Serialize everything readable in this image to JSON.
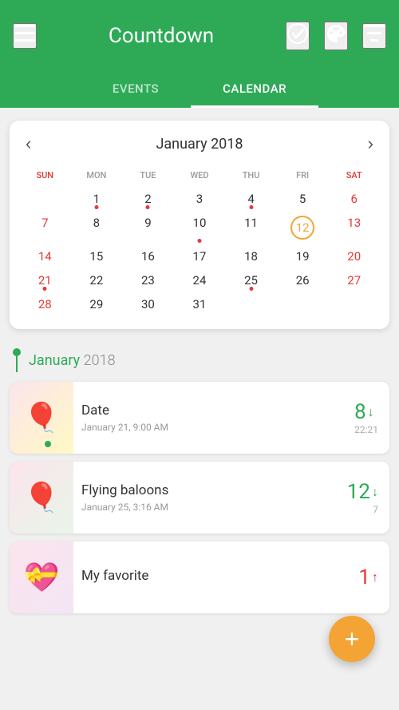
{
  "header": {
    "title": "Countdown",
    "menu_icon": "☰",
    "check_icon": "✓",
    "palette_icon": "🎨",
    "sort_icon": "≡"
  },
  "tabs": [
    {
      "label": "EVENTS",
      "active": false
    },
    {
      "label": "CALENDAR",
      "active": true
    }
  ],
  "calendar": {
    "title": "January 2018",
    "prev_label": "‹",
    "next_label": "›",
    "day_headers": [
      "SUN",
      "MON",
      "TUE",
      "WED",
      "THU",
      "FRI",
      "SAT"
    ],
    "weeks": [
      [
        {
          "day": "",
          "dot": false
        },
        {
          "day": "1",
          "dot": true
        },
        {
          "day": "2",
          "dot": true
        },
        {
          "day": "3",
          "dot": false
        },
        {
          "day": "4",
          "dot": true
        },
        {
          "day": "5",
          "dot": false
        },
        {
          "day": "6",
          "dot": false
        }
      ],
      [
        {
          "day": "7",
          "dot": false
        },
        {
          "day": "8",
          "dot": false
        },
        {
          "day": "9",
          "dot": false
        },
        {
          "day": "10",
          "dot": true
        },
        {
          "day": "11",
          "dot": false
        },
        {
          "day": "12",
          "dot": false,
          "today": true
        },
        {
          "day": "13",
          "dot": false
        }
      ],
      [
        {
          "day": "14",
          "dot": false
        },
        {
          "day": "15",
          "dot": false
        },
        {
          "day": "16",
          "dot": false
        },
        {
          "day": "17",
          "dot": false
        },
        {
          "day": "18",
          "dot": false
        },
        {
          "day": "19",
          "dot": false
        },
        {
          "day": "20",
          "dot": false
        }
      ],
      [
        {
          "day": "21",
          "dot": true
        },
        {
          "day": "22",
          "dot": false
        },
        {
          "day": "23",
          "dot": false
        },
        {
          "day": "24",
          "dot": false
        },
        {
          "day": "25",
          "dot": true
        },
        {
          "day": "26",
          "dot": false
        },
        {
          "day": "27",
          "dot": false
        }
      ],
      [
        {
          "day": "28",
          "dot": false
        },
        {
          "day": "29",
          "dot": false
        },
        {
          "day": "30",
          "dot": false
        },
        {
          "day": "31",
          "dot": false
        },
        {
          "day": "",
          "dot": false
        },
        {
          "day": "",
          "dot": false
        },
        {
          "day": "",
          "dot": false
        }
      ]
    ]
  },
  "events_section": {
    "month": "January",
    "year": "2018",
    "items": [
      {
        "id": "date",
        "title": "Date",
        "date": "January 21, 9:00 AM",
        "count": "8",
        "count_sub": "22:21",
        "direction": "down",
        "emoji": "🎈"
      },
      {
        "id": "flying-baloons",
        "title": "Flying baloons",
        "date": "January 25, 3:16 AM",
        "count": "12",
        "count_sub": "7",
        "direction": "down",
        "emoji": "🎈"
      },
      {
        "id": "my-favorite",
        "title": "My favorite",
        "date": "",
        "count": "1",
        "count_sub": "",
        "direction": "up",
        "emoji": "💝"
      }
    ]
  },
  "fab": {
    "label": "+"
  }
}
